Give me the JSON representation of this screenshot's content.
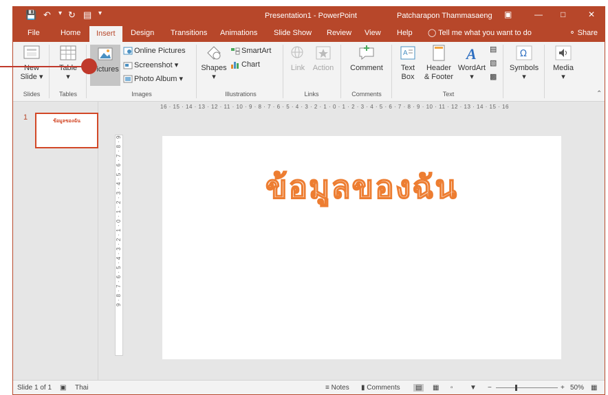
{
  "titlebar": {
    "title": "Presentation1 - PowerPoint",
    "user": "Patcharapon Thammasaeng"
  },
  "tabs": [
    "File",
    "Home",
    "Insert",
    "Design",
    "Transitions",
    "Animations",
    "Slide Show",
    "Review",
    "View",
    "Help"
  ],
  "active_tab": "Insert",
  "tell_me": "Tell me what you want to do",
  "share_label": "Share",
  "ribbon": {
    "slides": {
      "new_slide": [
        "New",
        "Slide"
      ],
      "group": "Slides"
    },
    "tables": {
      "table": "Table",
      "group": "Tables"
    },
    "images": {
      "pictures": "Pictures",
      "online_pictures": "Online Pictures",
      "screenshot": "Screenshot",
      "photo_album": "Photo Album",
      "group": "Images"
    },
    "illustrations": {
      "shapes": "Shapes",
      "smartart": "SmartArt",
      "chart": "Chart",
      "group": "Illustrations"
    },
    "links": {
      "link": "Link",
      "action": "Action",
      "group": "Links"
    },
    "comments": {
      "comment": "Comment",
      "group": "Comments"
    },
    "text": {
      "text_box": [
        "Text",
        "Box"
      ],
      "header_footer": [
        "Header",
        "& Footer"
      ],
      "wordart": "WordArt",
      "group": "Text"
    },
    "symbols": {
      "label": "Symbols"
    },
    "media": {
      "label": "Media"
    }
  },
  "slide_panel": {
    "slide_number": "1",
    "thumb_text": "ข้อมูลของฉัน"
  },
  "slide": {
    "title": "ข้อมูลของฉัน"
  },
  "rulers": {
    "horizontal": "16 · 15 · 14 · 13 · 12 · 11 · 10 · 9 · 8 · 7 · 6 · 5 · 4 · 3 · 2 · 1 · 0 · 1 · 2 · 3 · 4 · 5 · 6 · 7 · 8 · 9 · 10 · 11 · 12 · 13 · 14 · 15 · 16",
    "vertical": "9 · 8 · 7 · 6 · 5 · 4 · 3 · 2 · 1 · 0 · 1 · 2 · 3 · 4 · 5 · 6 · 7 · 8 · 9"
  },
  "statusbar": {
    "slide_info": "Slide 1 of 1",
    "language": "Thai",
    "notes": "Notes",
    "comments": "Comments",
    "zoom": "50%"
  },
  "colors": {
    "accent": "#b7472a",
    "title_outline": "#ed7d31",
    "callout": "#c0392b"
  }
}
